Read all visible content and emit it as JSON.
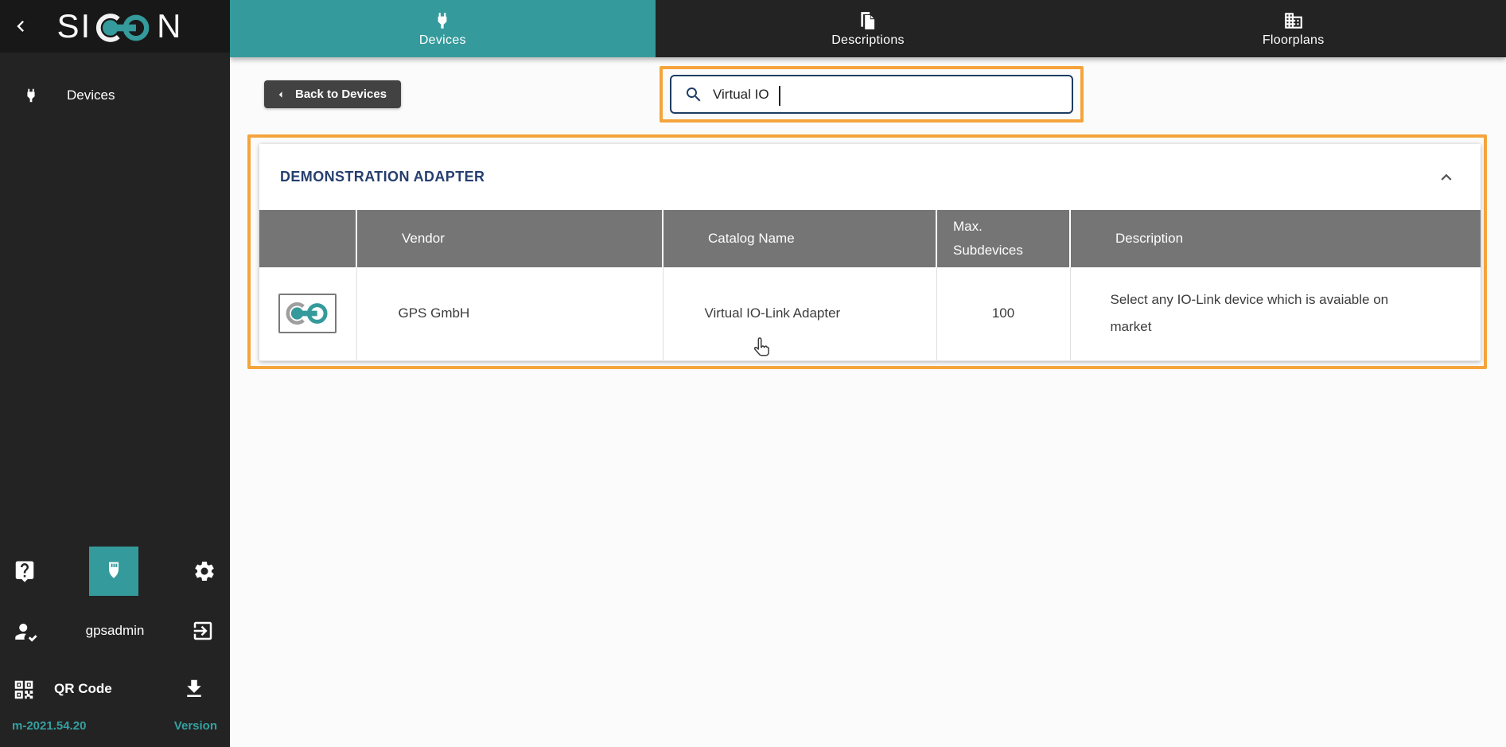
{
  "app": {
    "logo_left": "SI",
    "logo_right": "N"
  },
  "sidebar": {
    "items": [
      {
        "label": "Devices"
      }
    ],
    "user": {
      "name": "gpsadmin"
    },
    "qr": {
      "label": "QR Code"
    },
    "version": {
      "value": "m-2021.54.20",
      "label": "Version"
    }
  },
  "tabs": [
    {
      "label": "Devices",
      "active": true
    },
    {
      "label": "Descriptions",
      "active": false
    },
    {
      "label": "Floorplans",
      "active": false
    }
  ],
  "toolbar": {
    "back_button": "Back to Devices",
    "search": {
      "value": "Virtual IO"
    }
  },
  "content": {
    "section_title": "DEMONSTRATION ADAPTER",
    "table": {
      "headers": {
        "vendor": "Vendor",
        "catalog": "Catalog Name",
        "max_subdevices": "Max. Subdevices",
        "description": "Description"
      },
      "rows": [
        {
          "vendor": "GPS GmbH",
          "catalog": "Virtual IO-Link Adapter",
          "max_subdevices": "100",
          "description": "Select any IO-Link device which is avaiable on market"
        }
      ]
    }
  },
  "icons": {
    "logo_mark": "io-link-connector",
    "sidebar_nav": "power-plug",
    "tabs": [
      "power-plug",
      "documents",
      "building"
    ],
    "bottom_row": [
      "help-bubble",
      "usb-plug",
      "gear"
    ],
    "user_row": [
      "person-check",
      "exit"
    ],
    "qr_row": [
      "qr-code",
      "download"
    ],
    "search": "magnifier",
    "collapse": "chevron-up"
  },
  "annotations": {
    "highlight_color": "#f5a43c",
    "highlighted": [
      "search-box",
      "result-table"
    ]
  },
  "colors": {
    "teal": "#359a9b",
    "orange": "#f5a43c",
    "navy": "#263f6f",
    "table_header_bg": "#757575",
    "sidebar_bg": "#232323"
  }
}
